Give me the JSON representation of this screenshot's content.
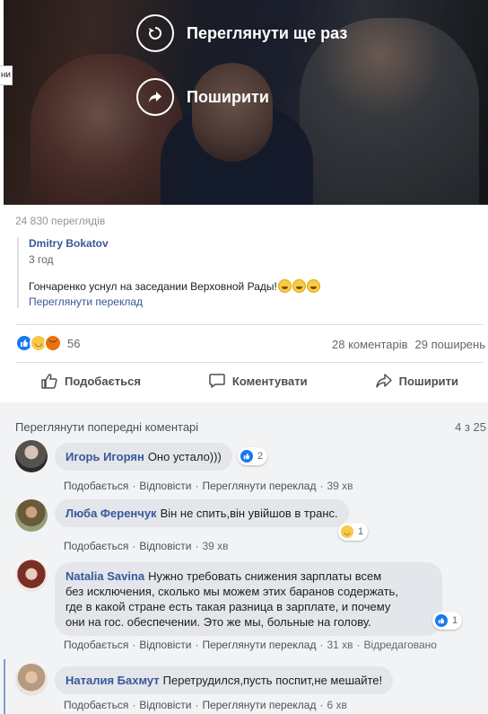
{
  "video": {
    "replay_label": "Переглянути ще раз",
    "share_label": "Поширити",
    "side_tab": "ни"
  },
  "post": {
    "views": "24 830 переглядів",
    "quote": {
      "author": "Dmitry Bokatov",
      "time": "3 год",
      "text": "Гончаренко уснул на заседании Верховной Рады!",
      "translate": "Переглянути переклад"
    },
    "reactions": {
      "count": "56",
      "icons": [
        "like-icon",
        "haha-icon",
        "angry-icon"
      ]
    },
    "comments_count": "28 коментарів",
    "shares_count": "29 поширень",
    "actions": {
      "like": "Подобається",
      "comment": "Коментувати",
      "share": "Поширити"
    }
  },
  "comments_section": {
    "view_previous": "Переглянути попередні коментарі",
    "counter": "4 з 25",
    "comments": [
      {
        "name": "Игорь Игорян",
        "text": "Оно устало)))",
        "like": "Подобається",
        "reply": "Відповісти",
        "translate": "Переглянути переклад",
        "time": "39 хв",
        "reaction_count": "2"
      },
      {
        "name": "Люба Ференчук",
        "text": "Він не спить,він увійшов в транс.",
        "like": "Подобається",
        "reply": "Відповісти",
        "time": "39 хв",
        "reaction_count": "1"
      },
      {
        "name": "Natalia Savina",
        "text_lines": [
          "Нужно требовать снижения зарплаты всем",
          "без исключения, сколько мы можем этих баранов содержать,",
          "где в какой стране есть такая разница в зарплате, и почему",
          "они на гос. обеспечении. Это же мы, больные на голову."
        ],
        "like": "Подобається",
        "reply": "Відповісти",
        "translate": "Переглянути переклад",
        "time": "31 хв",
        "edited": "Відредаговано",
        "reaction_count": "1"
      },
      {
        "name": "Наталия Бахмут",
        "text": "Перетрудился,пусть поспит,не мешайте!",
        "like": "Подобається",
        "reply": "Відповісти",
        "translate": "Переглянути переклад",
        "time": "6 хв"
      }
    ]
  },
  "colors": {
    "link": "#385898",
    "like_blue": "#1877f2",
    "bubble": "#e4e6eb",
    "section_bg": "#f2f3f5"
  }
}
